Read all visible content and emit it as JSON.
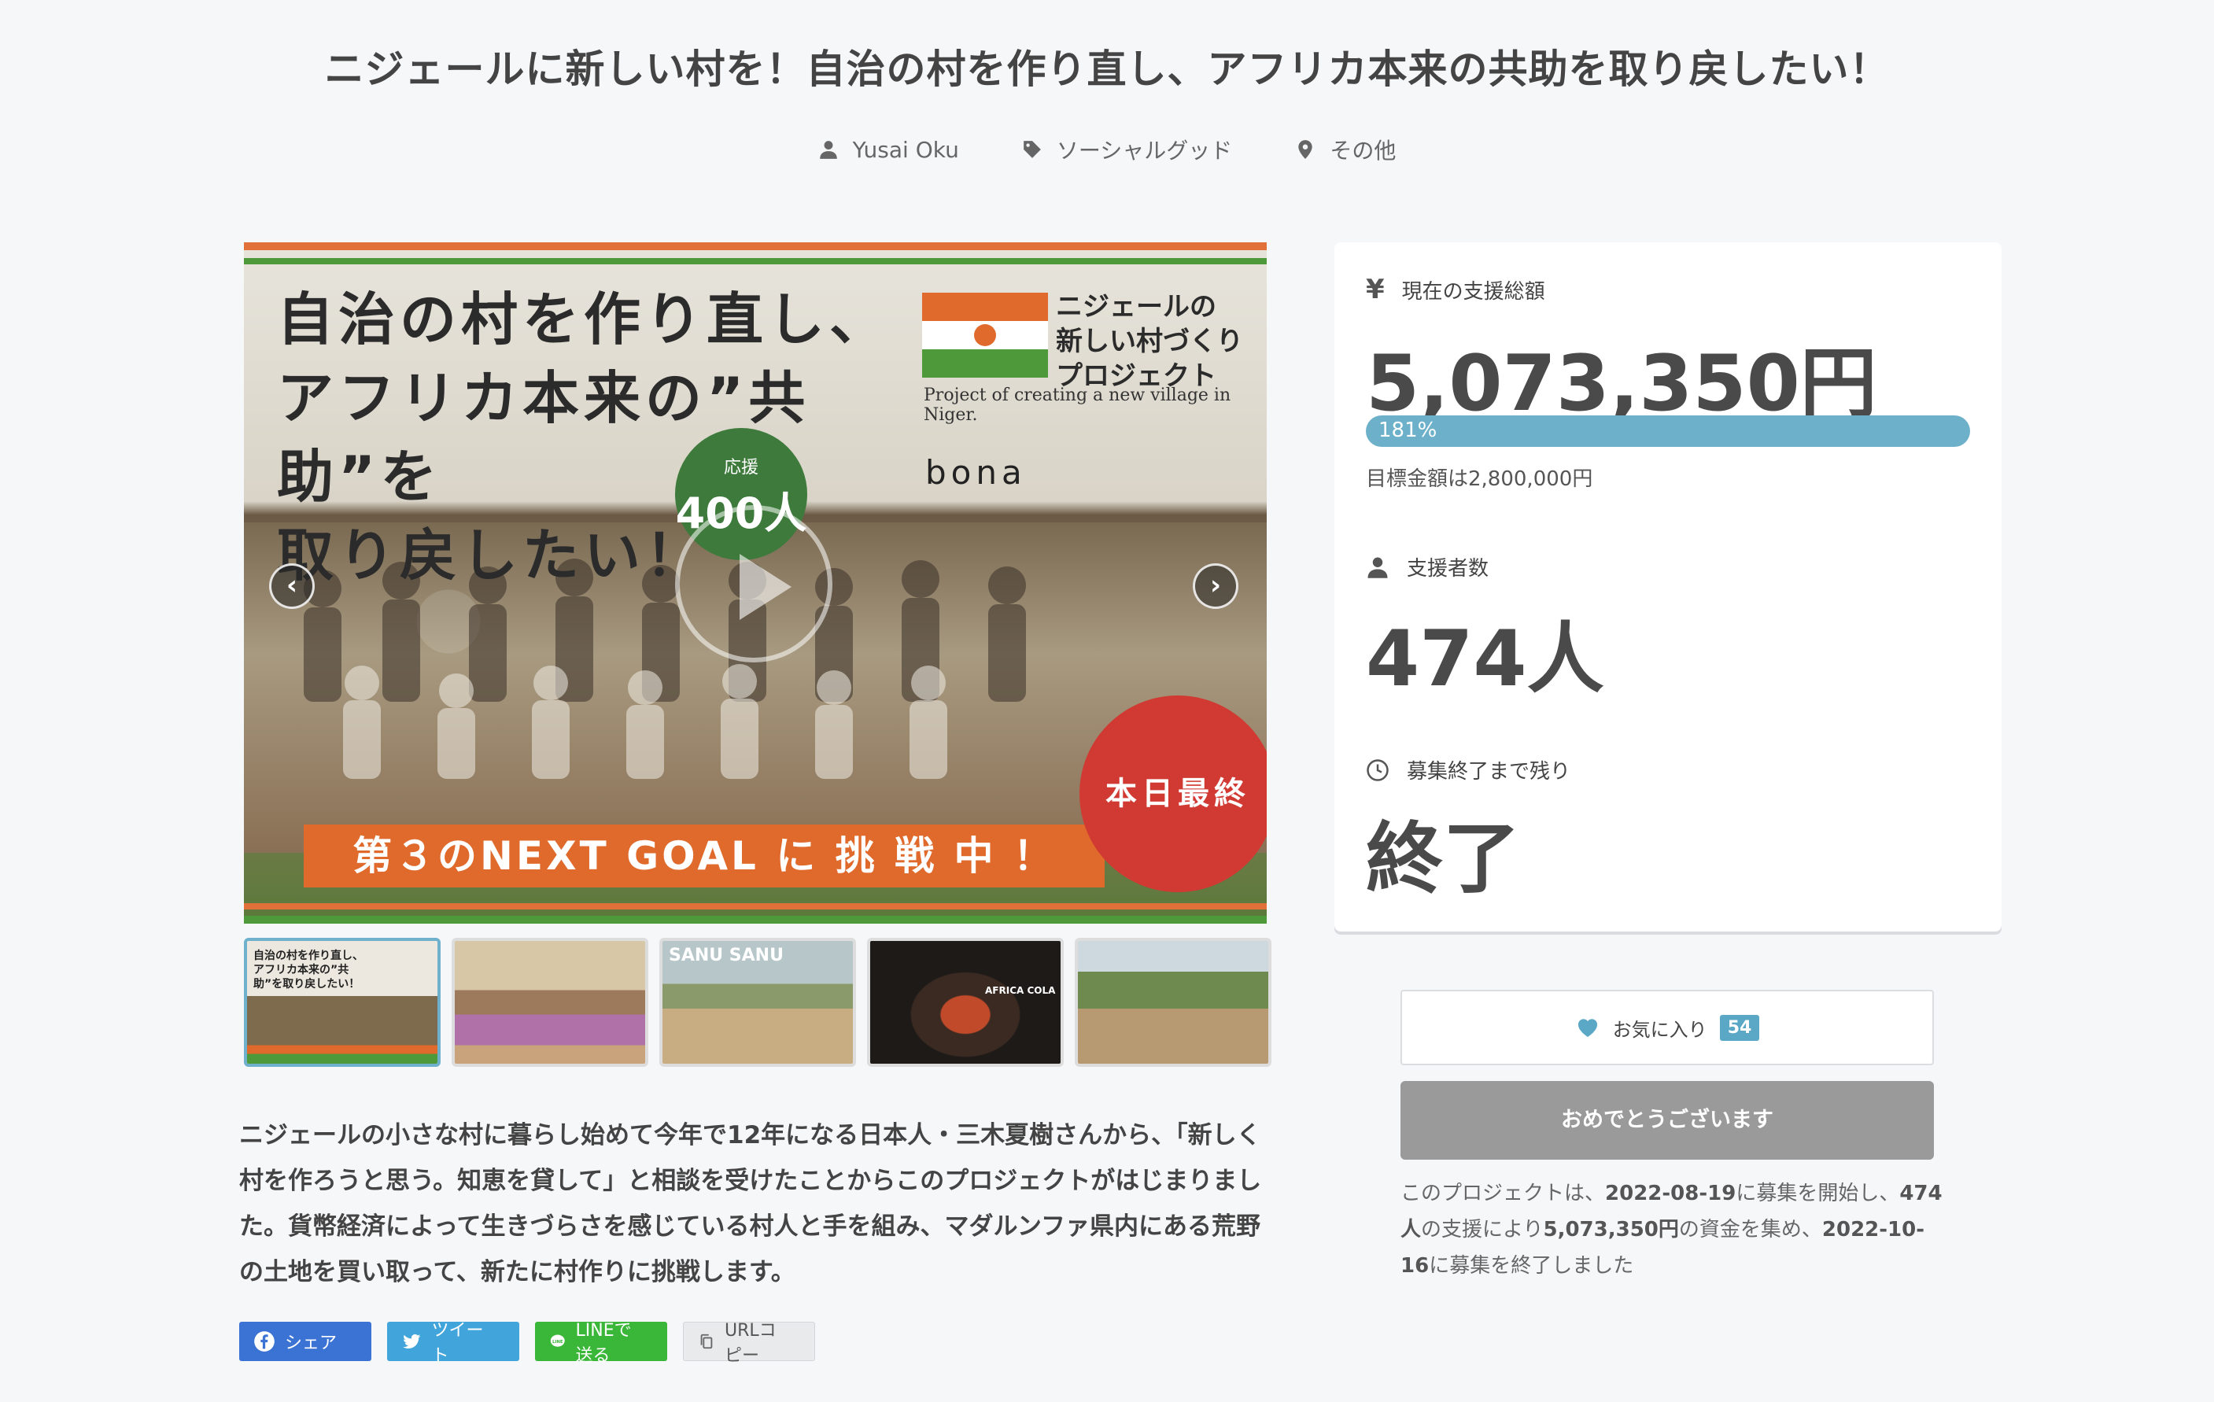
{
  "title": "ニジェールに新しい村を！自治の村を作り直し、アフリカ本来の共助を取り戻したい！",
  "meta": {
    "author": "Yusai Oku",
    "category": "ソーシャルグッド",
    "location": "その他"
  },
  "hero": {
    "headline_lines": [
      "自治の村を作り直し、",
      "アフリカ本来の”共助”を",
      "取り戻したい！"
    ],
    "logo_lines": [
      "ニジェールの",
      "新しい村づくり",
      "プロジェクト"
    ],
    "english": "Project of creating a new village in Niger.",
    "brand": "bona",
    "badge_small": "応援",
    "badge_large": "400人",
    "goal_banner": "第３のNEXT GOAL に 挑 戦 中 ！",
    "last_day": "本日最終日！",
    "prev": "‹",
    "next": "›"
  },
  "thumbs": [
    {
      "caption": "自治の村を作り直し、アフリカ本来の”共助”を取り戻したい！",
      "active": true
    },
    {
      "caption": "",
      "active": false
    },
    {
      "caption": "SANU SANU",
      "active": false
    },
    {
      "caption": "AFRICA COLA",
      "active": false
    },
    {
      "caption": "",
      "active": false
    }
  ],
  "description": "ニジェールの小さな村に暮らし始めて今年で12年になる日本人・三木夏樹さんから、「新しく村を作ろうと思う。知恵を貸して」と相談を受けたことからこのプロジェクトがはじまりました。貨幣経済によって生きづらさを感じている村人と手を組み、マダルンファ県内にある荒野の土地を買い取って、新たに村作りに挑戦します。",
  "share": {
    "facebook": "シェア",
    "twitter": "ツイート",
    "line": "LINEで送る",
    "url": "URLコピー"
  },
  "stats": {
    "amount_label": "現在の支援総額",
    "amount_value": "5,073,350円",
    "progress_text": "181%",
    "progress_percent": 181,
    "goal_text": "目標金額は2,800,000円",
    "backers_label": "支援者数",
    "backers_value": "474人",
    "remaining_label": "募集終了まで残り",
    "remaining_value": "終了"
  },
  "favorite": {
    "label": "お気に入り",
    "count": "54"
  },
  "thanks_button": "おめでとうございます",
  "summary": {
    "p1": "このプロジェクトは、",
    "start_date": "2022-08-19",
    "p2": "に募集を開始し、",
    "backers": "474人",
    "p3": "の支援により",
    "amount": "5,073,350円",
    "p4": "の資金を集め、",
    "end_date": "2022-10-16",
    "p5": "に募集を終了しました"
  },
  "colors": {
    "accent": "#6db0c9",
    "facebook": "#3b73d5",
    "twitter": "#41a5dc",
    "line": "#3ab638",
    "orange": "#e06a2c",
    "green": "#4e9a3a"
  }
}
